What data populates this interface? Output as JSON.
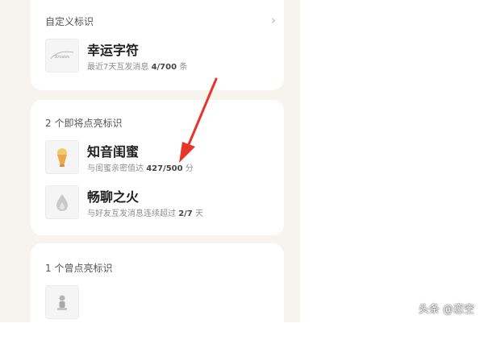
{
  "custom_section": {
    "title": "自定义标识",
    "item": {
      "logo_text": "Xroutes",
      "title": "幸运字符",
      "sub_prefix": "最近7天互发消息",
      "sub_value": "4/700",
      "sub_suffix": "条"
    }
  },
  "upcoming_section": {
    "title": "2 个即将点亮标识",
    "items": [
      {
        "icon": "bestie-icon",
        "title": "知音闺蜜",
        "sub_prefix": "与闺蜜亲密值达",
        "sub_value": "427/500",
        "sub_suffix": "分"
      },
      {
        "icon": "flame-icon",
        "title": "畅聊之火",
        "sub_prefix": "与好友互发消息连续超过",
        "sub_value": "2/7",
        "sub_suffix": "天"
      }
    ]
  },
  "lit_section": {
    "title": "1 个曾点亮标识",
    "items": [
      {
        "icon": "figure-icon"
      }
    ]
  },
  "watermark": "头条 @恋空",
  "colors": {
    "background": "#f7f3ee",
    "card": "#ffffff",
    "annotation_arrow": "#e8352a"
  }
}
